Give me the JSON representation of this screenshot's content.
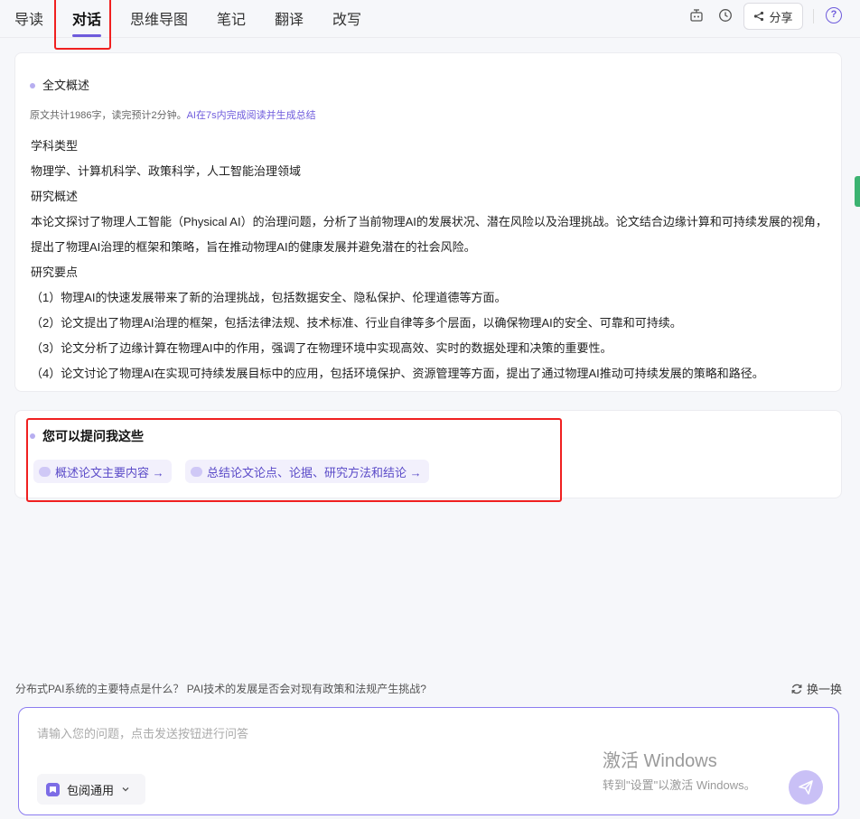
{
  "tabs": [
    {
      "label": "导读"
    },
    {
      "label": "对话"
    },
    {
      "label": "思维导图"
    },
    {
      "label": "笔记"
    },
    {
      "label": "翻译"
    },
    {
      "label": "改写"
    }
  ],
  "toolbar": {
    "share_label": "分享",
    "help_label": "?"
  },
  "summary": {
    "title": "全文概述",
    "stats_prefix": "原文共计1986字，读完预计2分钟。",
    "stats_highlight": "AI在7s内完成阅读并生成总结",
    "lines": [
      "学科类型",
      "物理学、计算机科学、政策科学，人工智能治理领域",
      "研究概述",
      "本论文探讨了物理人工智能（Physical AI）的治理问题，分析了当前物理AI的发展状况、潜在风险以及治理挑战。论文结合边缘计算和可持续发展的视角，提出了物理AI治理的框架和策略，旨在推动物理AI的健康发展并避免潜在的社会风险。",
      "研究要点",
      "（1）物理AI的快速发展带来了新的治理挑战，包括数据安全、隐私保护、伦理道德等方面。",
      "（2）论文提出了物理AI治理的框架，包括法律法规、技术标准、行业自律等多个层面，以确保物理AI的安全、可靠和可持续。",
      "（3）论文分析了边缘计算在物理AI中的作用，强调了在物理环境中实现高效、实时的数据处理和决策的重要性。",
      "（4）论文讨论了物理AI在实现可持续发展目标中的应用，包括环境保护、资源管理等方面，提出了通过物理AI推动可持续发展的策略和路径。"
    ]
  },
  "suggest": {
    "title": "您可以提问我这些",
    "chips": [
      {
        "label": "概述论文主要内容 →"
      },
      {
        "label": "总结论文论点、论据、研究方法和结论 →"
      }
    ]
  },
  "bottom": {
    "hint_questions": "分布式PAI系统的主要特点是什么？  PAI技术的发展是否会对现有政策和法规产生挑战?",
    "refresh_label": "换一换",
    "input_placeholder": "请输入您的问题，点击发送按钮进行问答",
    "model_label": "包阅通用"
  },
  "watermark": {
    "title": "激活 Windows",
    "subtitle": "转到\"设置\"以激活 Windows。"
  }
}
